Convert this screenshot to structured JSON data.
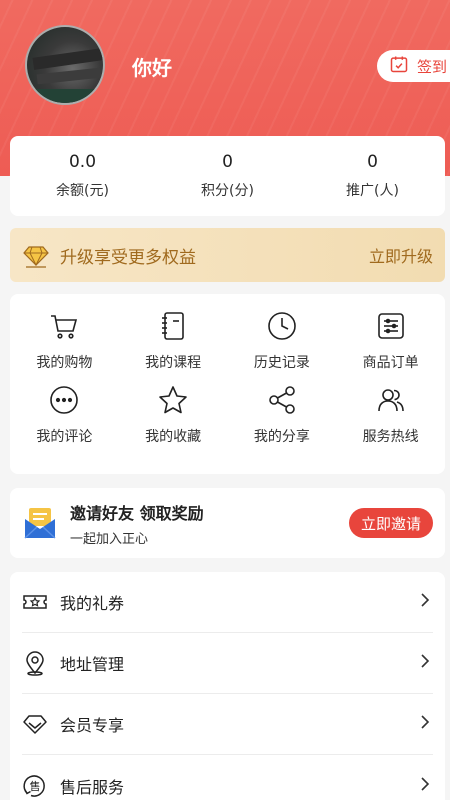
{
  "user": {
    "name": "你好",
    "signin_label": "签到"
  },
  "stats": [
    {
      "value": "0.0",
      "label": "余额(元)"
    },
    {
      "value": "0",
      "label": "积分(分)"
    },
    {
      "value": "0",
      "label": "推广(人)"
    }
  ],
  "vip": {
    "text": "升级享受更多权益",
    "action": "立即升级"
  },
  "grid": [
    {
      "label": "我的购物",
      "icon": "cart-icon"
    },
    {
      "label": "我的课程",
      "icon": "notebook-icon"
    },
    {
      "label": "历史记录",
      "icon": "clock-icon"
    },
    {
      "label": "商品订单",
      "icon": "list-icon"
    },
    {
      "label": "我的评论",
      "icon": "comment-icon"
    },
    {
      "label": "我的收藏",
      "icon": "star-icon"
    },
    {
      "label": "我的分享",
      "icon": "share-icon"
    },
    {
      "label": "服务热线",
      "icon": "users-icon"
    }
  ],
  "invite": {
    "title": "邀请好友 领取奖励",
    "subtitle": "一起加入正心",
    "action": "立即邀请"
  },
  "menu": [
    {
      "label": "我的礼券",
      "icon": "ticket-icon"
    },
    {
      "label": "地址管理",
      "icon": "location-icon"
    },
    {
      "label": "会员专享",
      "icon": "diamond-icon"
    },
    {
      "label": "售后服务",
      "icon": "after-sale-icon",
      "icon_text": "售"
    }
  ],
  "colors": {
    "header": "#ee5c54",
    "accent": "#e8453c",
    "gold": "#a06a1e"
  }
}
